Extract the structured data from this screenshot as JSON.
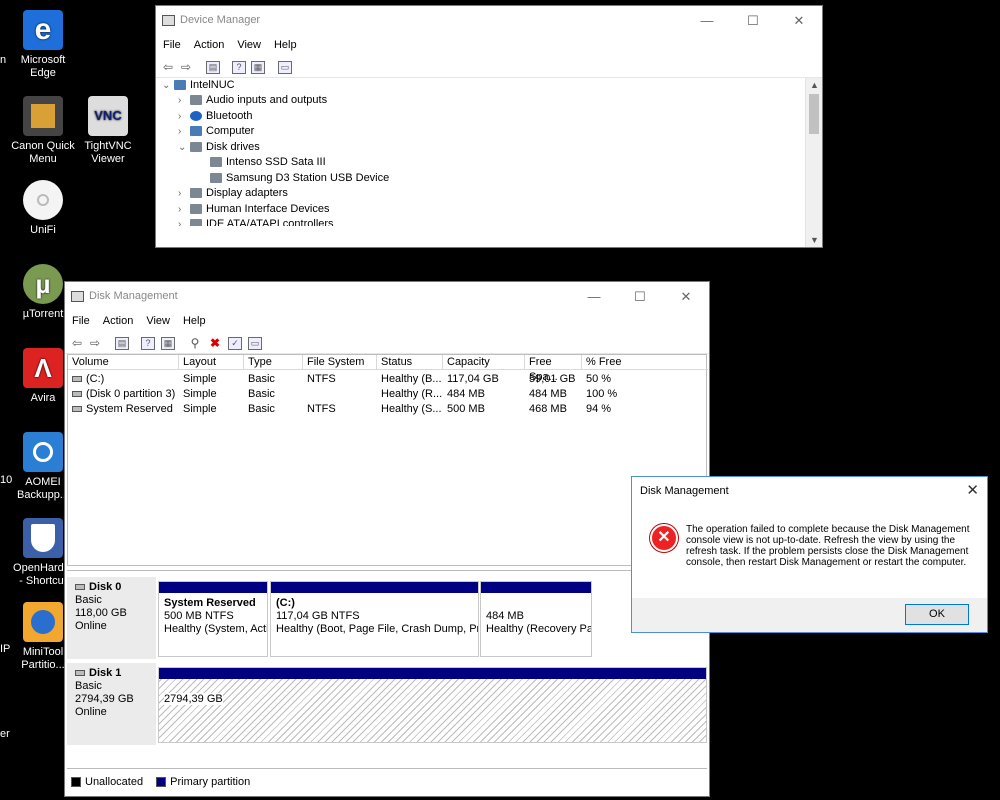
{
  "desktop": {
    "icons": [
      {
        "label": "Microsoft Edge",
        "icon": "edge-icon",
        "color": "#1e6fd9"
      },
      {
        "label": "Canon Quick Menu",
        "icon": "canon-icon",
        "color": "#444"
      },
      {
        "label": "TightVNC Viewer",
        "icon": "vnc-icon",
        "color": "#ddd"
      },
      {
        "label": "UniFi",
        "icon": "unifi-icon",
        "color": "#f4f4f4"
      },
      {
        "label": "µTorrent",
        "icon": "utorrent-icon",
        "color": "#7a9a52"
      },
      {
        "label": "Avira",
        "icon": "avira-icon",
        "color": "#d22"
      },
      {
        "label": "AOMEI Backupp...",
        "icon": "aomei-icon",
        "color": "#2a7fd4"
      },
      {
        "label": "OpenHard... - Shortcut",
        "icon": "openhard-icon",
        "color": "#3b5fa8"
      },
      {
        "label": "MiniTool Partitio...",
        "icon": "minitool-icon",
        "color": "#f2a72e"
      }
    ],
    "edge_fragments": [
      "n",
      "10",
      "IP",
      "er"
    ]
  },
  "device_manager": {
    "title": "Device Manager",
    "menu": [
      "File",
      "Action",
      "View",
      "Help"
    ],
    "tree": [
      {
        "label": "IntelNUC",
        "level": 0,
        "expander": "⌄"
      },
      {
        "label": "Audio inputs and outputs",
        "level": 1,
        "expander": "›"
      },
      {
        "label": "Bluetooth",
        "level": 1,
        "expander": "›"
      },
      {
        "label": "Computer",
        "level": 1,
        "expander": "›"
      },
      {
        "label": "Disk drives",
        "level": 1,
        "expander": "⌄"
      },
      {
        "label": "Intenso  SSD Sata III",
        "level": 2,
        "expander": ""
      },
      {
        "label": "Samsung D3 Station USB Device",
        "level": 2,
        "expander": ""
      },
      {
        "label": "Display adapters",
        "level": 1,
        "expander": "›"
      },
      {
        "label": "Human Interface Devices",
        "level": 1,
        "expander": "›"
      },
      {
        "label": "IDE ATA/ATAPI controllers",
        "level": 1,
        "expander": "›"
      }
    ]
  },
  "disk_management": {
    "title": "Disk Management",
    "menu": [
      "File",
      "Action",
      "View",
      "Help"
    ],
    "columns": [
      "Volume",
      "Layout",
      "Type",
      "File System",
      "Status",
      "Capacity",
      "Free Spa...",
      "% Free"
    ],
    "rows": [
      [
        "(C:)",
        "Simple",
        "Basic",
        "NTFS",
        "Healthy (B...",
        "117,04 GB",
        "59,01 GB",
        "50 %"
      ],
      [
        "(Disk 0 partition 3)",
        "Simple",
        "Basic",
        "",
        "Healthy (R...",
        "484 MB",
        "484 MB",
        "100 %"
      ],
      [
        "System Reserved",
        "Simple",
        "Basic",
        "NTFS",
        "Healthy (S...",
        "500 MB",
        "468 MB",
        "94 %"
      ]
    ],
    "disk0": {
      "name": "Disk 0",
      "type": "Basic",
      "size": "118,00 GB",
      "state": "Online",
      "partitions": [
        {
          "name": "System Reserved",
          "info": "500 MB NTFS",
          "status": "Healthy (System, Acti"
        },
        {
          "name": "(C:)",
          "info": "117,04 GB NTFS",
          "status": "Healthy (Boot, Page File, Crash Dump, Prim"
        },
        {
          "name": "",
          "info": "484 MB",
          "status": "Healthy (Recovery Par"
        }
      ]
    },
    "disk1": {
      "name": "Disk 1",
      "type": "Basic",
      "size": "2794,39 GB",
      "state": "Online",
      "partition_size": "2794,39 GB"
    },
    "legend": {
      "unallocated": "Unallocated",
      "primary": "Primary partition",
      "unallocated_color": "#000000",
      "primary_color": "#000080"
    }
  },
  "dialog": {
    "title": "Disk Management",
    "message": "The operation failed to complete because the Disk Management console view is not up-to-date.  Refresh the view by using the refresh task. If the problem persists close the Disk Management console, then restart Disk Management or restart the computer.",
    "ok_label": "OK"
  }
}
